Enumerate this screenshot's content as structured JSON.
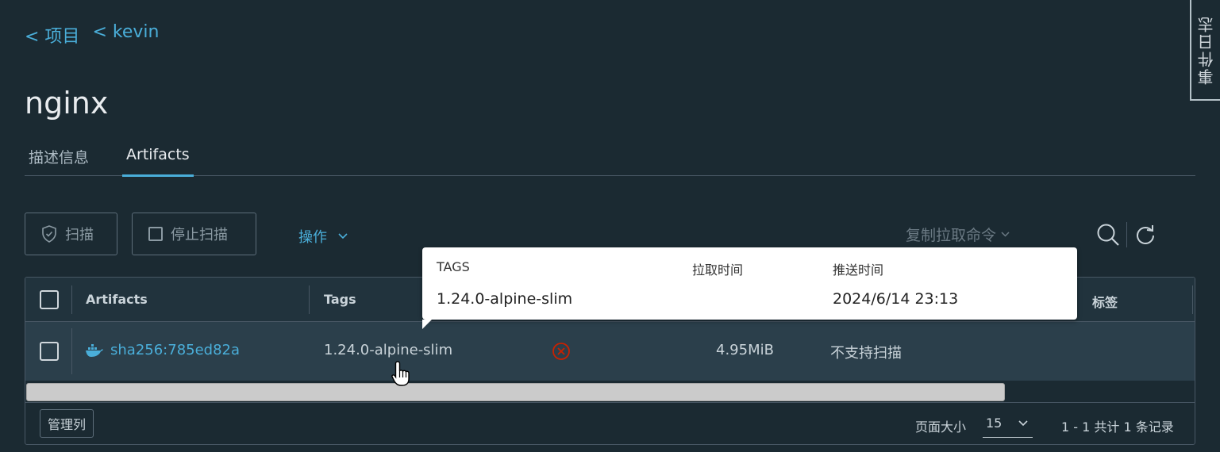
{
  "breadcrumb": {
    "projects": "< 项目",
    "project": "< kevin"
  },
  "repo_title": "nginx",
  "tabs": [
    {
      "label": "描述信息"
    },
    {
      "label": "Artifacts"
    }
  ],
  "toolbar": {
    "scan_label": "扫描",
    "stop_scan_label": "停止扫描",
    "actions_label": "操作",
    "pull_command_label": "复制拉取命令"
  },
  "grid": {
    "headers": {
      "artifacts": "Artifacts",
      "tags": "Tags",
      "labels": "标签"
    },
    "rows": [
      {
        "digest": "sha256:785ed82a",
        "tags": "1.24.0-alpine-slim",
        "size": "4.95MiB",
        "vulnerabilities": "不支持扫描"
      }
    ],
    "footer": {
      "manage_columns": "管理列",
      "page_size_label": "页面大小",
      "page_size_value": "15",
      "page_info": "1 - 1 共计 1 条记录"
    }
  },
  "tooltip": {
    "headers": {
      "tags": "TAGS",
      "pull_time": "拉取时间",
      "push_time": "推送时间"
    },
    "row": {
      "tag": "1.24.0-alpine-slim",
      "pull_time": "",
      "push_time": "2024/6/14 23:13"
    }
  },
  "event_log_label": "事件日志",
  "colors": {
    "accent": "#4aaed9",
    "background": "#1b2a32",
    "row_highlight": "#2b3f4b",
    "error": "#c92100"
  }
}
